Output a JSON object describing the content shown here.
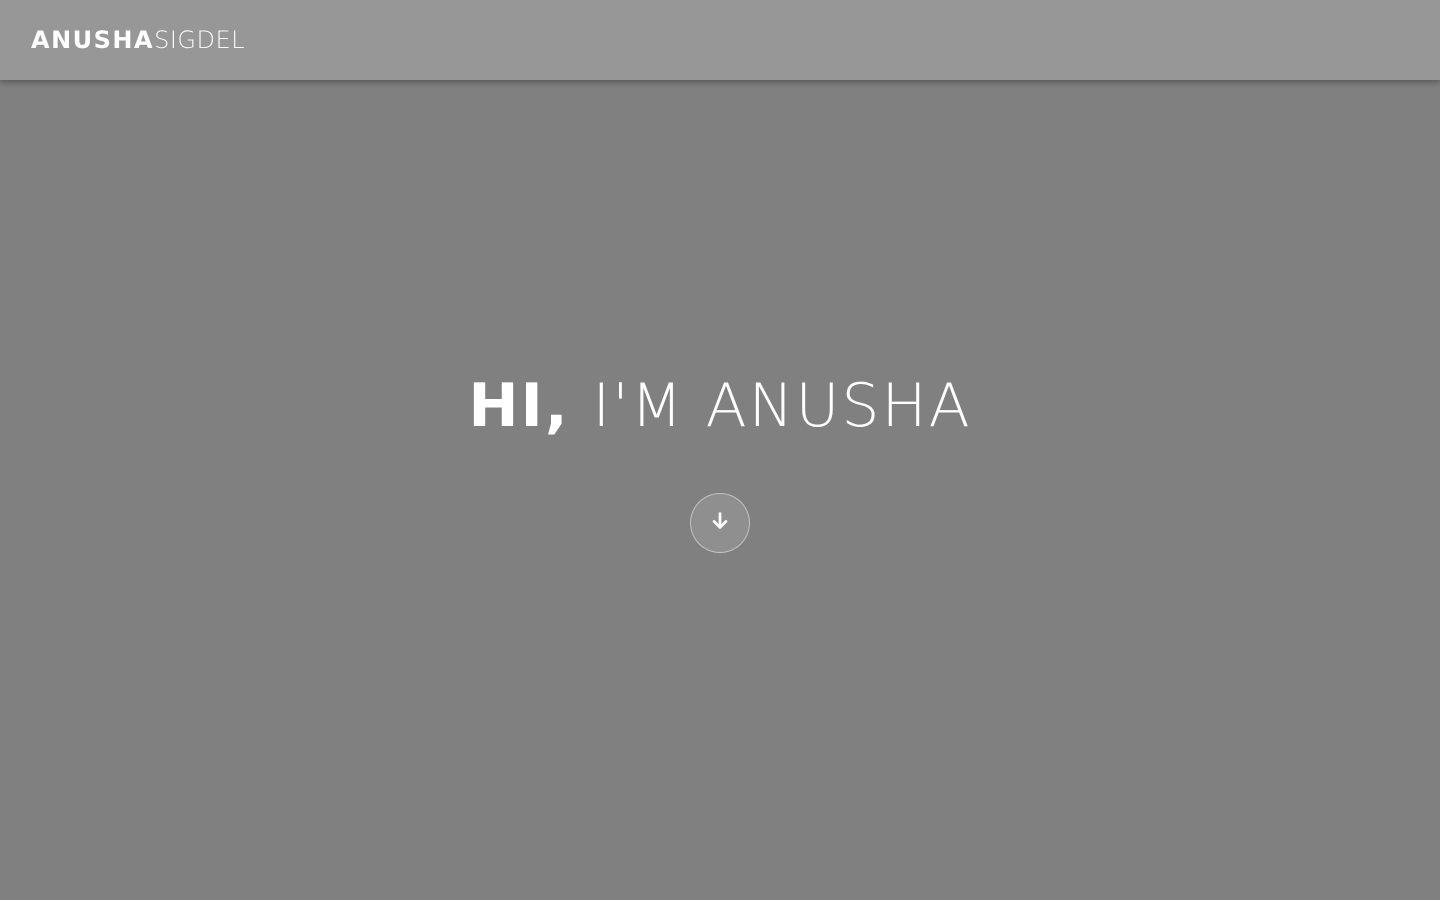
{
  "navbar": {
    "brand_first": "ANUSHA",
    "brand_last": "SIGDEL"
  },
  "hero": {
    "greeting": "HI,",
    "intro": "I'M ANUSHA",
    "scroll_icon": "arrow-down-icon"
  },
  "colors": {
    "background": "#808080",
    "navbar": "#979797",
    "text": "#ffffff"
  }
}
